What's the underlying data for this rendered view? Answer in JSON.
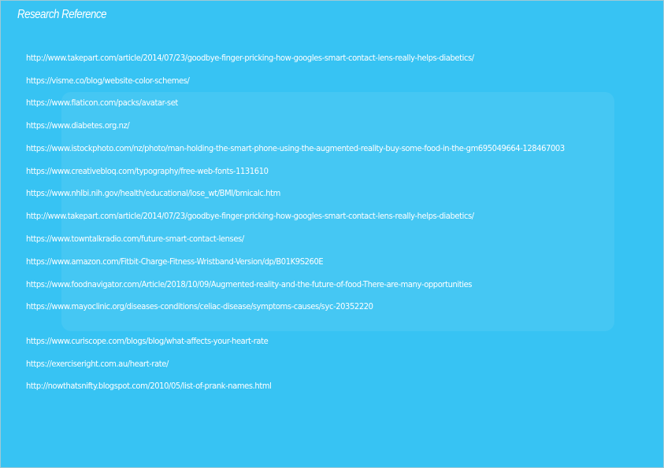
{
  "page": {
    "title": "Research Reference",
    "background_color": "#37c3f3",
    "text_color": "#ffffff"
  },
  "references": [
    "http://www.takepart.com/article/2014/07/23/goodbye-finger-pricking-how-googles-smart-contact-lens-really-helps-diabetics/",
    "https://visme.co/blog/website-color-schemes/",
    "https://www.flaticon.com/packs/avatar-set",
    "https://www.diabetes.org.nz/",
    "https://www.istockphoto.com/nz/photo/man-holding-the-smart-phone-using-the-augmented-reality-buy-some-food-in-the-gm695049664-128467003",
    "https://www.creativebloq.com/typography/free-web-fonts-1131610",
    "https://www.nhlbi.nih.gov/health/educational/lose_wt/BMI/bmicalc.htm",
    "http://www.takepart.com/article/2014/07/23/goodbye-finger-pricking-how-googles-smart-contact-lens-really-helps-diabetics/",
    "https://www.towntalkradio.com/future-smart-contact-lenses/",
    "https://www.amazon.com/Fitbit-Charge-Fitness-Wristband-Version/dp/B01K9S260E",
    "https://www.foodnavigator.com/Article/2018/10/09/Augmented-reality-and-the-future-of-food-There-are-many-opportunities",
    "https://www.mayoclinic.org/diseases-conditions/celiac-disease/symptoms-causes/syc-20352220",
    "https://www.curiscope.com/blogs/blog/what-affects-your-heart-rate",
    "https://exerciseright.com.au/heart-rate/",
    "http://nowthatsnifty.blogspot.com/2010/05/list-of-prank-names.html"
  ]
}
